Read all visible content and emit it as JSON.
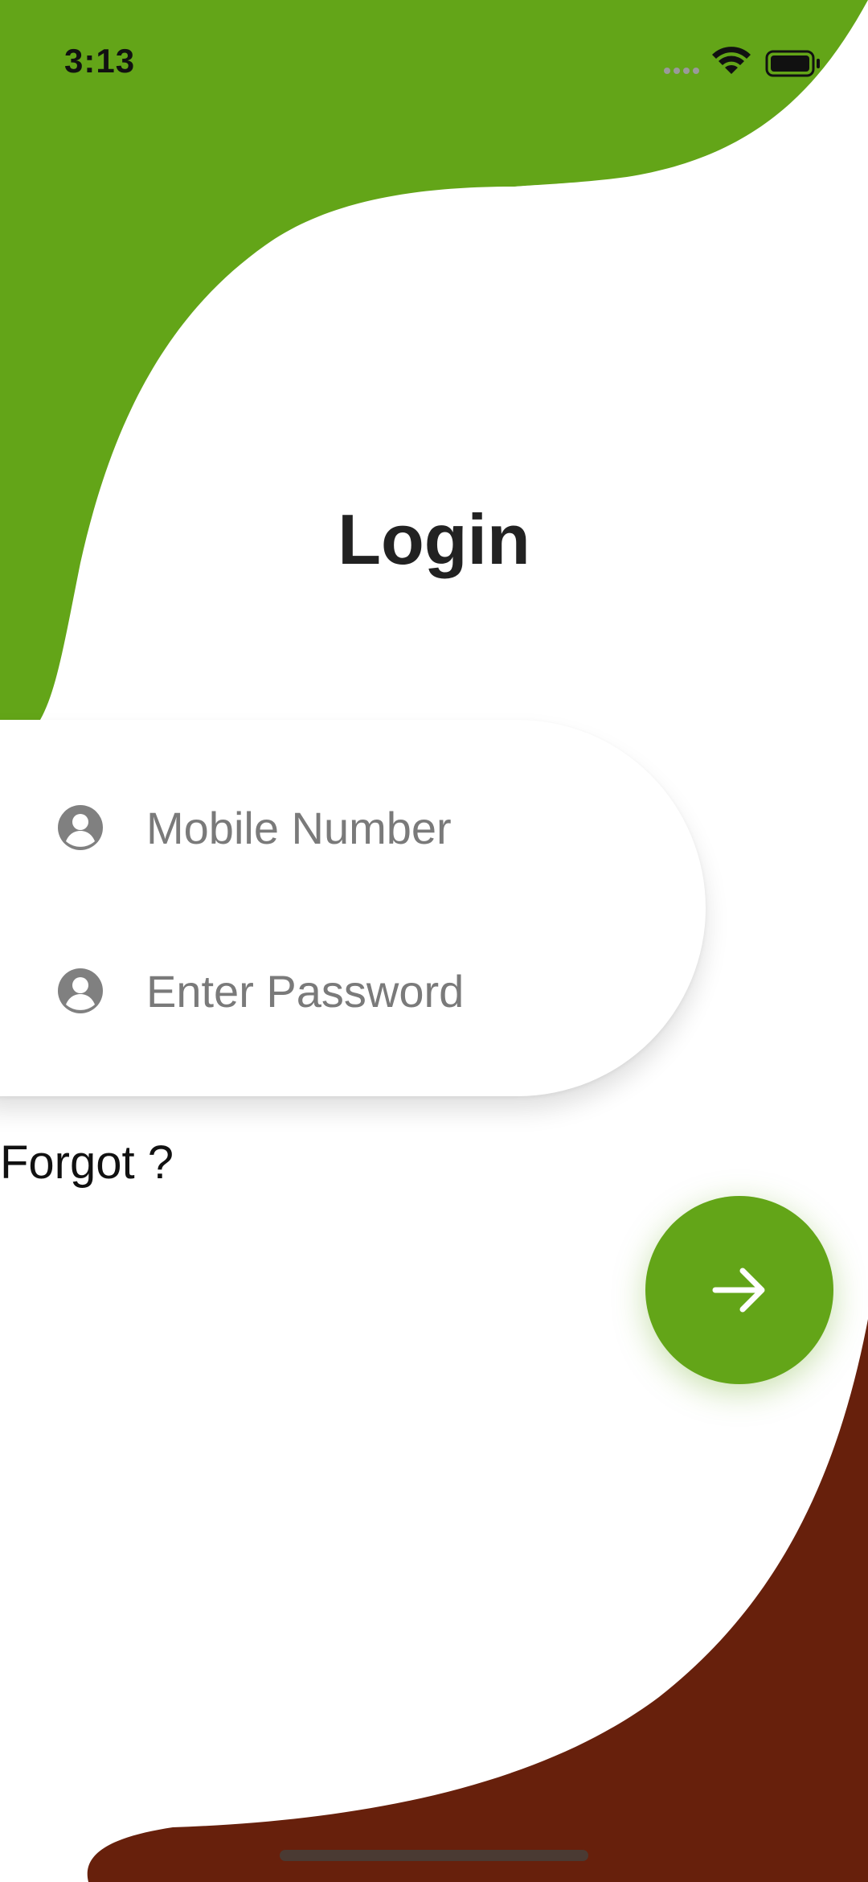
{
  "colors": {
    "green": "#63a518",
    "brown": "#67200c",
    "text_dark": "#222222",
    "placeholder": "#7a7a7a",
    "icon_gray": "#808080"
  },
  "status_bar": {
    "time": "3:13",
    "icons": [
      "signal-dots-icon",
      "wifi-icon",
      "battery-icon"
    ]
  },
  "login": {
    "title": "Login",
    "mobile_placeholder": "Mobile Number",
    "password_placeholder": "Enter Password",
    "forgot_label": "Forgot ?",
    "field_icon": "account-circle-icon",
    "submit_icon": "arrow-right-icon"
  }
}
